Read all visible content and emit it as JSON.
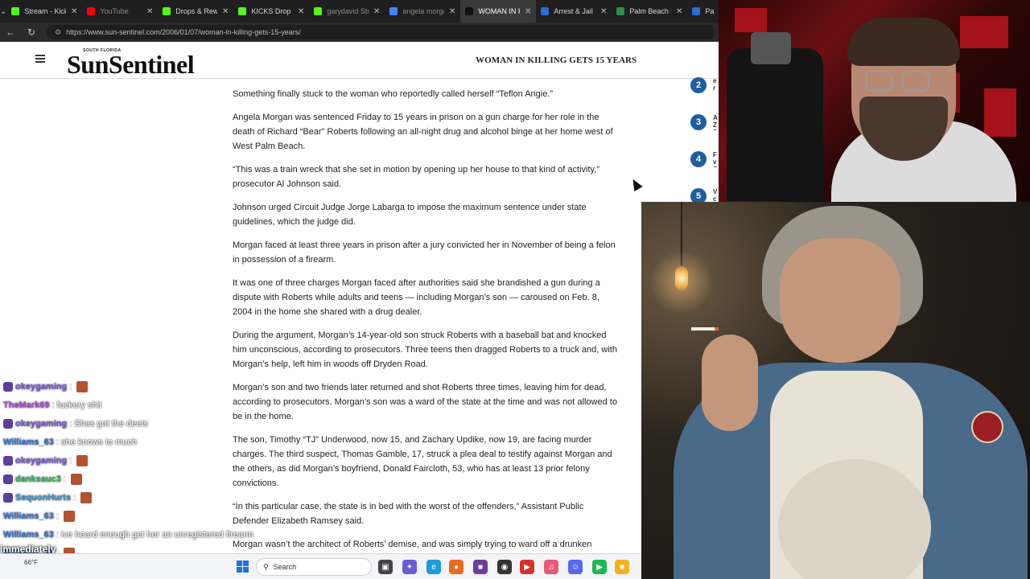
{
  "browser": {
    "tabs": [
      {
        "label": "Stream - Kick D",
        "favicon": "kick-icon",
        "color": "#53fc18",
        "active": false
      },
      {
        "label": "YouTube",
        "favicon": "youtube-icon",
        "color": "#ff0000",
        "active": false
      },
      {
        "label": "Drops & Rewar",
        "favicon": "kick-icon",
        "color": "#53fc18",
        "active": false
      },
      {
        "label": "KICKS Drop is",
        "favicon": "kick-icon",
        "color": "#53fc18",
        "active": false
      },
      {
        "label": "garydavid Stre",
        "favicon": "kick-icon",
        "color": "#53fc18",
        "active": false
      },
      {
        "label": "angela morgan",
        "favicon": "google-icon",
        "color": "#4285f4",
        "active": false
      },
      {
        "label": "WOMAN IN KIL",
        "favicon": "sun-sentinel-icon",
        "color": "#111111",
        "active": true
      },
      {
        "label": "Arrest & Jail - F",
        "favicon": "star-icon",
        "color": "#2d6bd6",
        "active": false
      },
      {
        "label": "Palm Beach Co",
        "favicon": "seal-icon",
        "color": "#2f8f46",
        "active": false
      },
      {
        "label": "Pal",
        "favicon": "star-icon",
        "color": "#2d6bd6",
        "active": false
      }
    ],
    "url": "https://www.sun-sentinel.com/2006/01/07/woman-in-killing-gets-15-years/"
  },
  "site": {
    "logo_small": "SOUTH FLORIDA",
    "logo": "SunSentinel",
    "header_title": "WOMAN IN KILLING GETS 15 YEARS",
    "accent": "#1f5e9e"
  },
  "article": {
    "paragraphs": [
      "Something finally stuck to the woman who reportedly called herself “Teflon Angie.”",
      "Angela Morgan was sentenced Friday to 15 years in prison on a gun charge for her role in the death of Richard “Bear” Roberts following an all-night drug and alcohol binge at her home west of West Palm Beach.",
      "“This was a train wreck that she set in motion by opening up her house to that kind of activity,” prosecutor Al Johnson said.",
      "Johnson urged Circuit Judge Jorge Labarga to impose the maximum sentence under state guidelines, which the judge did.",
      "Morgan faced at least three years in prison after a jury convicted her in November of being a felon in possession of a firearm.",
      "It was one of three charges Morgan faced after authorities said she brandished a gun during a dispute with Roberts while adults and teens — including Morgan’s son — caroused on Feb. 8, 2004 in the home she shared with a drug dealer.",
      "During the argument, Morgan’s 14-year-old son struck Roberts with a baseball bat and knocked him unconscious, according to prosecutors. Three teens then dragged Roberts to a truck and, with Morgan’s help, left him in woods off Dryden Road.",
      "Morgan’s son and two friends later returned and shot Roberts three times, leaving him for dead, according to prosecutors. Morgan’s son was a ward of the state at the time and was not allowed to be in the home.",
      "The son, Timothy “TJ” Underwood, now 15, and Zachary Updike, now 19, are facing murder charges. The third suspect, Thomas Gamble, 17, struck a plea deal to testify against Morgan and the others, as did Morgan’s boyfriend, Donald Faircloth, 53, who has at least 13 prior felony convictions.",
      "“In this particular case, the state is in bed with the worst of the offenders,” Assistant Public Defender Elizabeth Ramsey said.",
      "Morgan wasn’t the architect of Roberts’ demise, and was simply trying to ward off a drunken"
    ]
  },
  "trending": [
    {
      "num": "2",
      "text": "e i r"
    },
    {
      "num": "3",
      "text": "A Z S"
    },
    {
      "num": "4",
      "text": "F v G"
    },
    {
      "num": "5",
      "text": "V c"
    }
  ],
  "chat": [
    {
      "user": "okeygaming",
      "sep": ":",
      "msg": "",
      "color": "#7b5cd6",
      "emote": true
    },
    {
      "user": "TheMark69",
      "sep": ":",
      "msg": "fuckery shit",
      "color": "#b44ad6",
      "emote": false
    },
    {
      "user": "okeygaming",
      "sep": ":",
      "msg": "Shes got the deets",
      "color": "#7b5cd6",
      "emote": false
    },
    {
      "user": "Williams_63",
      "sep": ":",
      "msg": "she knows to much",
      "color": "#3a78d8",
      "emote": false
    },
    {
      "user": "okeygaming",
      "sep": ":",
      "msg": "",
      "color": "#7b5cd6",
      "emote": true
    },
    {
      "user": "danksauc3",
      "sep": ":",
      "msg": "",
      "color": "#2fbf5a",
      "emote": true
    },
    {
      "user": "SequonHurts",
      "sep": ":",
      "msg": "",
      "color": "#3a9ad8",
      "emote": true
    },
    {
      "user": "Williams_63",
      "sep": ":",
      "msg": "",
      "color": "#3a78d8",
      "emote": true
    },
    {
      "user": "Williams_63",
      "sep": ":",
      "msg": "ive heard enough get her an unregistered firearm",
      "color": "#3a78d8",
      "emote": false
    },
    {
      "user": "Williams_63",
      "sep": ":",
      "msg": "",
      "color": "#3a78d8",
      "emote": true
    }
  ],
  "caption": "immediately",
  "taskbar": {
    "weather": "66°F",
    "search_placeholder": "Search"
  }
}
